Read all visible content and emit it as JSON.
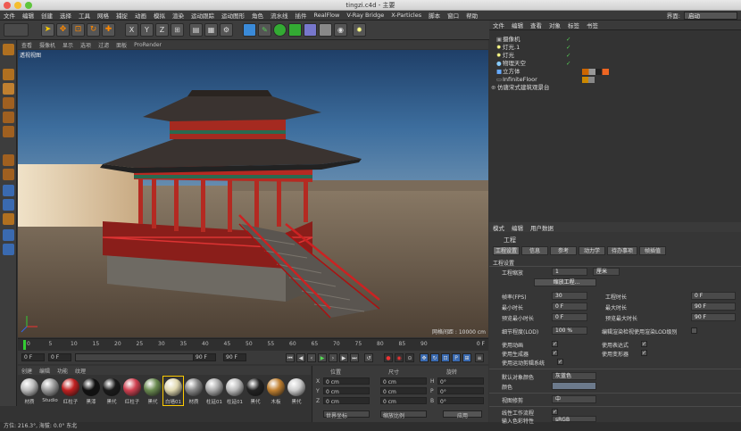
{
  "window": {
    "title": "tingzi.c4d - 主要"
  },
  "menu": [
    "文件",
    "编辑",
    "创建",
    "选择",
    "工具",
    "网格",
    "捕捉",
    "动画",
    "模拟",
    "渲染",
    "运动跟踪",
    "运动图形",
    "角色",
    "流水线",
    "插件",
    "RealFlow",
    "V-Ray Bridge",
    "X-Particles",
    "脚本",
    "窗口",
    "帮助"
  ],
  "layout": {
    "label": "界面:",
    "value": "启动"
  },
  "toolbar": {
    "xyz": [
      "X",
      "Y",
      "Z"
    ]
  },
  "viewport": {
    "menu": [
      "查看",
      "摄像机",
      "显示",
      "选项",
      "过滤",
      "面板",
      "ProRender"
    ],
    "label": "透视视图",
    "grid_label": "网格间距 : 10000 cm"
  },
  "timeline": {
    "ticks": [
      "0",
      "5",
      "10",
      "15",
      "20",
      "25",
      "30",
      "35",
      "40",
      "45",
      "50",
      "55",
      "60",
      "65",
      "70",
      "75",
      "80",
      "85",
      "90"
    ],
    "frame_display": "0 F"
  },
  "transport": {
    "start": "0 F",
    "current": "0 F",
    "end": "90 F",
    "end2": "90 F"
  },
  "materials": {
    "menu": [
      "创建",
      "编辑",
      "功能",
      "纹理"
    ],
    "items": [
      {
        "name": "材质",
        "color": "#bbbbbb"
      },
      {
        "name": "Studio",
        "color": "#9a9a9a"
      },
      {
        "name": "红柱子",
        "color": "#c02020"
      },
      {
        "name": "黑漆",
        "color": "#111111"
      },
      {
        "name": "黑代",
        "color": "#1a1a1a"
      },
      {
        "name": "红柱子",
        "color": "#d04050"
      },
      {
        "name": "黑代",
        "color": "#6a8a50"
      },
      {
        "name": "白墙01",
        "color": "#e0d8b0"
      },
      {
        "name": "材质",
        "color": "#888888"
      },
      {
        "name": "柱延01",
        "color": "#aaaaaa"
      },
      {
        "name": "柱延01",
        "color": "#bbbbbb"
      },
      {
        "name": "黑代",
        "color": "#222222"
      },
      {
        "name": "木板",
        "color": "#c08030"
      },
      {
        "name": "黑代",
        "color": "#cccccc"
      }
    ]
  },
  "coords": {
    "header": [
      "位置",
      "尺寸",
      "旋转"
    ],
    "rows": [
      {
        "axis": "X",
        "pos": "0 cm",
        "size": "0 cm",
        "rot_label": "H",
        "rot": "0°"
      },
      {
        "axis": "Y",
        "pos": "0 cm",
        "size": "0 cm",
        "rot_label": "P",
        "rot": "0°"
      },
      {
        "axis": "Z",
        "pos": "0 cm",
        "size": "0 cm",
        "rot_label": "B",
        "rot": "0°"
      }
    ],
    "mode": "世界坐标",
    "scale": "缩放比例",
    "apply": "应用"
  },
  "objects": {
    "menu": [
      "文件",
      "编辑",
      "查看",
      "对象",
      "标签",
      "书签"
    ],
    "items": [
      {
        "name": "摄像机"
      },
      {
        "name": "灯光.1"
      },
      {
        "name": "灯光"
      },
      {
        "name": "物理天空"
      },
      {
        "name": "立方体"
      },
      {
        "name": "InfiniteFloor"
      },
      {
        "name": "仿唐宋式建筑观景台"
      }
    ]
  },
  "attributes": {
    "menu": [
      "模式",
      "编辑",
      "用户数据"
    ],
    "title": "工程",
    "tabs": [
      "工程设置",
      "信息",
      "参考",
      "动力学",
      "待办事项",
      "帧插值"
    ],
    "section": "工程设置",
    "project_scale_label": "工程缩放",
    "project_scale_value": "1",
    "project_scale_unit": "厘米",
    "scale_button": "缩放工程...",
    "fps_label": "帧率(FPS)",
    "fps": "30",
    "min_time_label": "最小时长",
    "min_time": "0 F",
    "preview_min_label": "预览最小时长",
    "preview_min": "0 F",
    "duration_label": "工程时长",
    "duration": "0 F",
    "max_time_label": "最大时长",
    "max_time": "90 F",
    "preview_max_label": "预览最大时长",
    "preview_max": "90 F",
    "lod_label": "细节程度(LOD)",
    "lod": "100 %",
    "lod_check": "编辑渲染检视使用渲染LOD级别",
    "use_anim": "使用动画",
    "use_expr": "使用表达式",
    "use_gen": "使用生成器",
    "use_deform": "使用变形器",
    "use_motion": "使用运动剪辑系统",
    "default_color_label": "默认对象颜色",
    "default_color": "灰蓝色",
    "color_label": "颜色",
    "view_label": "视图修剪",
    "view_value": "中",
    "linear_label": "线性工作流程",
    "input_label": "输入色彩特性",
    "input_value": "sRGB"
  },
  "status": "方位: 216.3°, 海拔: 0.0° 东北"
}
